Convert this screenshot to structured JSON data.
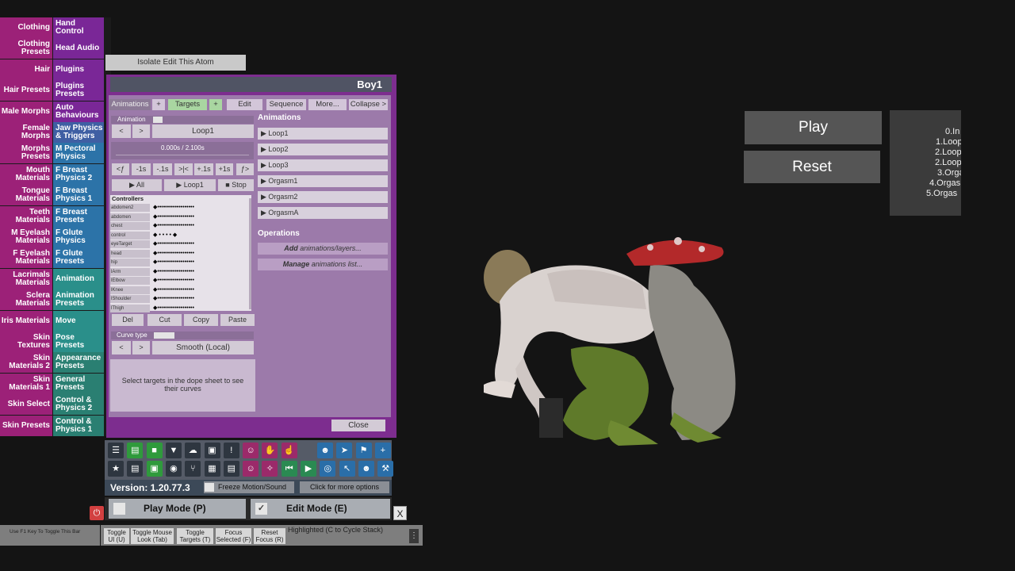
{
  "left_menu": {
    "rows": [
      {
        "left": "Clothing",
        "right": "Hand Control",
        "lcolor": "#9c2178",
        "rcolor": "#7a2797"
      },
      {
        "left": "Clothing Presets",
        "right": "Head Audio",
        "lcolor": "#9c2178",
        "rcolor": "#7a2797"
      },
      {
        "left": "Hair",
        "right": "Plugins",
        "lcolor": "#9c2178",
        "rcolor": "#7a2797"
      },
      {
        "left": "Hair Presets",
        "right": "Plugins Presets",
        "lcolor": "#9c2178",
        "rcolor": "#7a2797"
      },
      {
        "left": "Male Morphs",
        "right": "Auto Behaviours",
        "lcolor": "#9c2178",
        "rcolor": "#7a2797"
      },
      {
        "left": "Female Morphs",
        "right": "Jaw Physics & Triggers",
        "lcolor": "#9c2178",
        "rcolor": "#3f5fa3"
      },
      {
        "left": "Morphs Presets",
        "right": "M Pectoral Physics",
        "lcolor": "#9c2178",
        "rcolor": "#2c73a8"
      },
      {
        "left": "Mouth Materials",
        "right": "F Breast Physics 2",
        "lcolor": "#9c2178",
        "rcolor": "#2c73a8"
      },
      {
        "left": "Tongue Materials",
        "right": "F Breast Physics 1",
        "lcolor": "#9c2178",
        "rcolor": "#2c73a8"
      },
      {
        "left": "Teeth Materials",
        "right": "F Breast Presets",
        "lcolor": "#9c2178",
        "rcolor": "#2c73a8"
      },
      {
        "left": "M Eyelash Materials",
        "right": "F Glute Physics",
        "lcolor": "#9c2178",
        "rcolor": "#2c73a8"
      },
      {
        "left": "F Eyelash Materials",
        "right": "F Glute Presets",
        "lcolor": "#9c2178",
        "rcolor": "#2c73a8"
      },
      {
        "left": "Lacrimals Materials",
        "right": "Animation",
        "lcolor": "#9c2178",
        "rcolor": "#2a8f8a"
      },
      {
        "left": "Sclera Materials",
        "right": "Animation Presets",
        "lcolor": "#9c2178",
        "rcolor": "#2a8f8a"
      },
      {
        "left": "Iris Materials",
        "right": "Move",
        "lcolor": "#9c2178",
        "rcolor": "#2a8f8a"
      },
      {
        "left": "Skin Textures",
        "right": "Pose Presets",
        "lcolor": "#9c2178",
        "rcolor": "#2a8f8a"
      },
      {
        "left": "Skin Materials 2",
        "right": "Appearance Presets",
        "lcolor": "#9c2178",
        "rcolor": "#2a7f72"
      },
      {
        "left": "Skin Materials 1",
        "right": "General Presets",
        "lcolor": "#9c2178",
        "rcolor": "#2a7f72"
      },
      {
        "left": "Skin Select",
        "right": "Control & Physics 2",
        "lcolor": "#9c2178",
        "rcolor": "#2a7f72"
      },
      {
        "left": "Skin Presets",
        "right": "Control & Physics 1",
        "lcolor": "#9c2178",
        "rcolor": "#2a7f72"
      }
    ]
  },
  "isolate_label": "Isolate Edit This Atom",
  "panel": {
    "title": "Boy1",
    "tabs": [
      {
        "label": "Animations",
        "key": "animations"
      },
      {
        "label": "+",
        "key": "add-anim"
      },
      {
        "label": "Targets",
        "key": "targets"
      },
      {
        "label": "+",
        "key": "add-target"
      },
      {
        "label": "Edit",
        "key": "edit"
      },
      {
        "label": "Sequence",
        "key": "sequence"
      },
      {
        "label": "More...",
        "key": "more"
      },
      {
        "label": "Collapse >",
        "key": "collapse"
      }
    ],
    "animation_label": "Animation",
    "prev": "<",
    "next": ">",
    "current_animation": "Loop1",
    "time_text": "0.000s / 2.100s",
    "scrub_buttons": [
      "<ƒ",
      "-1s",
      "-.1s",
      ">|<",
      "+.1s",
      "+1s",
      "ƒ>"
    ],
    "play_all": "▶ All",
    "play_current": "▶ Loop1",
    "stop": "■ Stop",
    "controllers_label": "Controllers",
    "controllers": [
      "abdomen2",
      "abdomen",
      "chest",
      "control",
      "eyeTarget",
      "head",
      "hip",
      "lArm",
      "lElbow",
      "lKnee",
      "lShoulder",
      "lThigh"
    ],
    "edit_buttons": [
      "Del",
      "Cut",
      "Copy",
      "Paste"
    ],
    "curve_type_label": "Curve type",
    "curve_type_value": "Smooth (Local)",
    "hint": "Select targets in the dope sheet to see their curves",
    "animations_heading": "Animations",
    "animations": [
      "▶ Loop1",
      "▶ Loop2",
      "▶ Loop3",
      "▶ Orgasm1",
      "▶ Orgasm2",
      "▶ OrgasmA"
    ],
    "operations_heading": "Operations",
    "op_add_em": "Add",
    "op_add_rest": " animations/layers...",
    "op_manage_em": "Manage",
    "op_manage_rest": " animations list...",
    "close_label": "Close"
  },
  "toolbar": {
    "row1": [
      {
        "icon": "menu-icon",
        "glyph": "☰",
        "color": "#2e3640"
      },
      {
        "icon": "open-scene-icon",
        "glyph": "▤",
        "color": "#2f9a3c"
      },
      {
        "icon": "folder-icon",
        "glyph": "■",
        "color": "#2f9a3c"
      },
      {
        "icon": "save-scene-icon",
        "glyph": "▼",
        "color": "#2e3640"
      },
      {
        "icon": "cloud-icon",
        "glyph": "☁",
        "color": "#2e3640"
      },
      {
        "icon": "package-icon",
        "glyph": "▣",
        "color": "#2e3640"
      },
      {
        "icon": "alert-icon",
        "glyph": "!",
        "color": "#2e3640"
      },
      {
        "icon": "person-add-icon",
        "glyph": "☺",
        "color": "#9b2a6a"
      },
      {
        "icon": "hand-icon",
        "glyph": "✋",
        "color": "#9b2a6a"
      },
      {
        "icon": "pointer-hand-icon",
        "glyph": "☝",
        "color": "#9b2a6a"
      },
      {
        "icon": "person-icon",
        "glyph": "☻",
        "color": "#2a6ea8"
      },
      {
        "icon": "send-icon",
        "glyph": "➤",
        "color": "#2a6ea8"
      },
      {
        "icon": "flag-icon",
        "glyph": "⚑",
        "color": "#2a6ea8"
      },
      {
        "icon": "plus-icon",
        "glyph": "+",
        "color": "#2a6ea8"
      }
    ],
    "row2": [
      {
        "icon": "star-icon",
        "glyph": "★",
        "color": "#2e3640"
      },
      {
        "icon": "open-folder-icon",
        "glyph": "▤",
        "color": "#2e3640"
      },
      {
        "icon": "image-icon",
        "glyph": "▣",
        "color": "#2f9a3c"
      },
      {
        "icon": "camera-icon",
        "glyph": "◉",
        "color": "#2e3640"
      },
      {
        "icon": "hierarchy-icon",
        "glyph": "⑂",
        "color": "#2e3640"
      },
      {
        "icon": "boxes-icon",
        "glyph": "▦",
        "color": "#2e3640"
      },
      {
        "icon": "document-icon",
        "glyph": "▤",
        "color": "#2e3640"
      },
      {
        "icon": "person-edit-icon",
        "glyph": "☺",
        "color": "#9b2a6a"
      },
      {
        "icon": "wand-icon",
        "glyph": "✧",
        "color": "#9b2a6a"
      },
      {
        "icon": "skip-back-icon",
        "glyph": "⏮",
        "color": "#2a8a52"
      },
      {
        "icon": "play-icon",
        "glyph": "▶",
        "color": "#2a8a52"
      },
      {
        "icon": "target-icon",
        "glyph": "◎",
        "color": "#2a6ea8"
      },
      {
        "icon": "cursor-icon",
        "glyph": "↖",
        "color": "#2a6ea8"
      },
      {
        "icon": "person-select-icon",
        "glyph": "☻",
        "color": "#2a6ea8"
      },
      {
        "icon": "tools-icon",
        "glyph": "⚒",
        "color": "#2a6ea8"
      }
    ]
  },
  "version_text": "Version: 1.20.77.3",
  "freeze_label": "Freeze Motion/Sound",
  "more_options_label": "Click for more options",
  "play_mode_label": "Play Mode (P)",
  "edit_mode_label": "Edit Mode (E)",
  "edit_mode_check": "✓",
  "power_glyph": "⏻",
  "x_label": "X",
  "bottom": {
    "left_hint": "Use F1 Key To Toggle This Bar",
    "buttons": [
      "Toggle UI (U)",
      "Toggle Mouse Look (Tab)",
      "Toggle Targets (T)",
      "Focus Selected (F)",
      "Reset Focus (R)"
    ],
    "highlighted": "Highlighted (C to Cycle Stack)",
    "menu_glyph": "⋮"
  },
  "right_panel": {
    "play": "Play",
    "reset": "Reset",
    "list": [
      "0.In",
      "1.Loop",
      "2.Loop",
      "2.Loop",
      "3.Orga",
      "4.Orgas",
      "5.Orgas"
    ]
  }
}
